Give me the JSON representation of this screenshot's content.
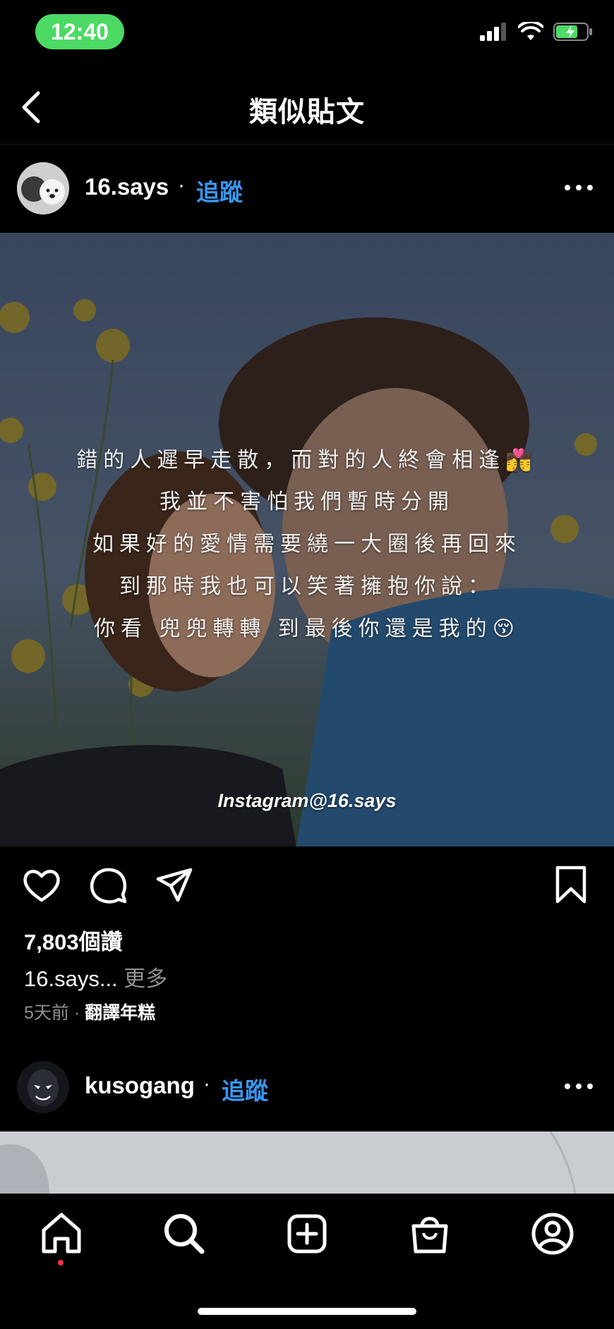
{
  "status_bar": {
    "time": "12:40"
  },
  "nav": {
    "title": "類似貼文"
  },
  "post1": {
    "username": "16.says",
    "separator": "·",
    "follow_label": "追蹤",
    "image_text_lines": [
      "錯的人遲早走散，而對的人終會相逢👩‍❤️‍💋‍👨",
      "我並不害怕我們暫時分開",
      "如果好的愛情需要繞一大圈後再回來",
      "到那時我也可以笑著擁抱你說：",
      "你看 兜兜轉轉 到最後你還是我的😚"
    ],
    "watermark": "Instagram@16.says",
    "likes": "7,803個讚",
    "caption_user": "16.says...",
    "caption_more": " 更多",
    "time_ago": "5天前",
    "meta_sep": " · ",
    "translate_label": "翻譯年糕"
  },
  "post2": {
    "username": "kusogang",
    "separator": "·",
    "follow_label": "追蹤"
  },
  "icons": {
    "back": "chevron-left-icon",
    "like": "heart-icon",
    "comment": "comment-icon",
    "share": "send-icon",
    "save": "bookmark-icon",
    "more": "more-horizontal-icon"
  },
  "colors": {
    "accent": "#3897f0",
    "status_pill": "#4cd964",
    "notification_dot": "#ff3040"
  }
}
